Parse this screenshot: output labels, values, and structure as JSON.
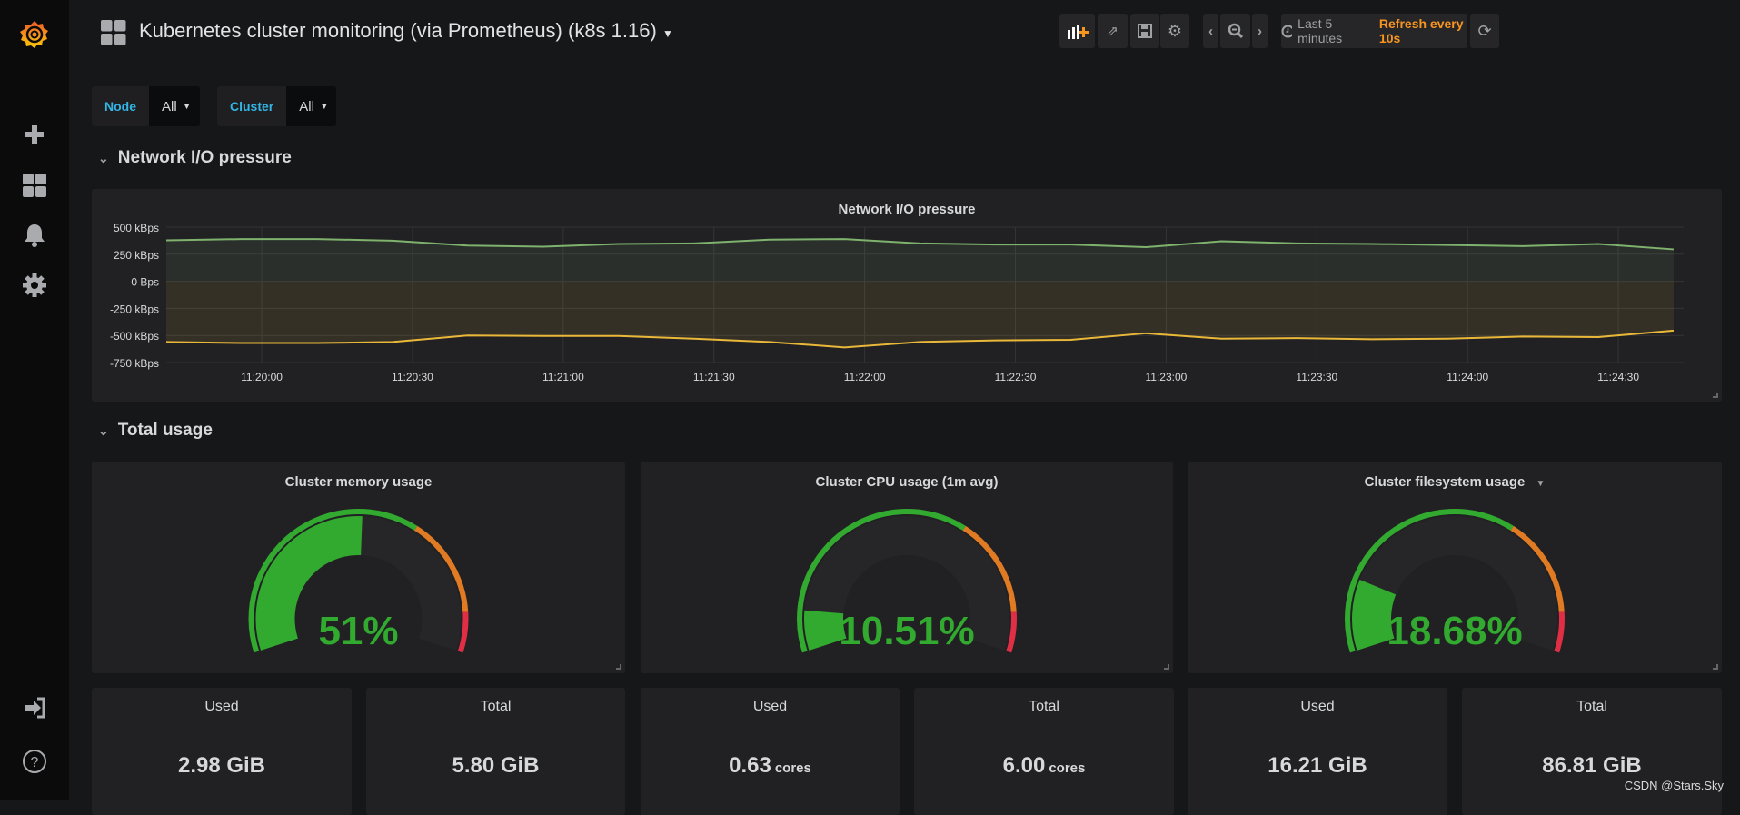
{
  "header": {
    "title": "Kubernetes cluster monitoring (via Prometheus) (k8s 1.16)",
    "time_range": "Last 5 minutes",
    "refresh": "Refresh every 10s"
  },
  "sidebar": {
    "items": [
      "grafana-logo",
      "plus-icon",
      "dashboards-icon",
      "alerting-icon",
      "configuration-icon",
      "sign-in-icon",
      "help-icon"
    ]
  },
  "variables": [
    {
      "label": "Node",
      "value": "All"
    },
    {
      "label": "Cluster",
      "value": "All"
    }
  ],
  "rows": [
    {
      "title": "Network I/O pressure"
    },
    {
      "title": "Total usage"
    }
  ],
  "colors": {
    "green": "#7eb26d",
    "yellow": "#eab839",
    "gauge_green": "#32a92f",
    "gauge_orange": "#e07b23",
    "gauge_red": "#e02f44",
    "refresh": "#f79520",
    "variable_label": "#33b5e5"
  },
  "chart_data": {
    "type": "line",
    "title": "Network I/O pressure",
    "x": [
      "11:19:41",
      "11:19:56",
      "11:20:11",
      "11:20:26",
      "11:20:41",
      "11:20:56",
      "11:21:11",
      "11:21:26",
      "11:21:41",
      "11:21:56",
      "11:22:11",
      "11:22:26",
      "11:22:41",
      "11:22:56",
      "11:23:11",
      "11:23:26",
      "11:23:41",
      "11:23:56",
      "11:24:11",
      "11:24:26",
      "11:24:41"
    ],
    "xlim": [
      "11:19:41",
      "11:24:43"
    ],
    "xticks": [
      "11:20:00",
      "11:20:30",
      "11:21:00",
      "11:21:30",
      "11:22:00",
      "11:22:30",
      "11:23:00",
      "11:23:30",
      "11:24:00",
      "11:24:30"
    ],
    "yticks": [
      "500 kBps",
      "250 kBps",
      "0 Bps",
      "-250 kBps",
      "-500 kBps",
      "-750 kBps"
    ],
    "ylim": [
      -750,
      500
    ],
    "yunit": "kBps",
    "grid": true,
    "series": [
      {
        "color": "#7eb26d",
        "values": [
          378,
          390,
          390,
          375,
          330,
          320,
          345,
          350,
          385,
          390,
          350,
          340,
          340,
          315,
          370,
          350,
          345,
          335,
          325,
          345,
          295
        ]
      },
      {
        "color": "#eab839",
        "values": [
          -560,
          -570,
          -570,
          -560,
          -500,
          -505,
          -505,
          -530,
          -560,
          -610,
          -560,
          -545,
          -540,
          -480,
          -530,
          -525,
          -535,
          -530,
          -510,
          -515,
          -455
        ]
      }
    ]
  },
  "gauges": [
    {
      "title": "Cluster memory usage",
      "value": 51,
      "display": "51%",
      "thresholds": [
        65,
        90
      ]
    },
    {
      "title": "Cluster CPU usage (1m avg)",
      "value": 10.51,
      "display": "10.51%",
      "thresholds": [
        65,
        90
      ]
    },
    {
      "title": "Cluster filesystem usage",
      "value": 18.68,
      "display": "18.68%",
      "thresholds": [
        65,
        90
      ]
    }
  ],
  "stats": [
    {
      "title": "Used",
      "value": "2.98 GiB",
      "unit": ""
    },
    {
      "title": "Total",
      "value": "5.80 GiB",
      "unit": ""
    },
    {
      "title": "Used",
      "value": "0.63",
      "unit": "cores"
    },
    {
      "title": "Total",
      "value": "6.00",
      "unit": "cores"
    },
    {
      "title": "Used",
      "value": "16.21 GiB",
      "unit": ""
    },
    {
      "title": "Total",
      "value": "86.81 GiB",
      "unit": ""
    }
  ],
  "watermark": "CSDN @Stars.Sky"
}
